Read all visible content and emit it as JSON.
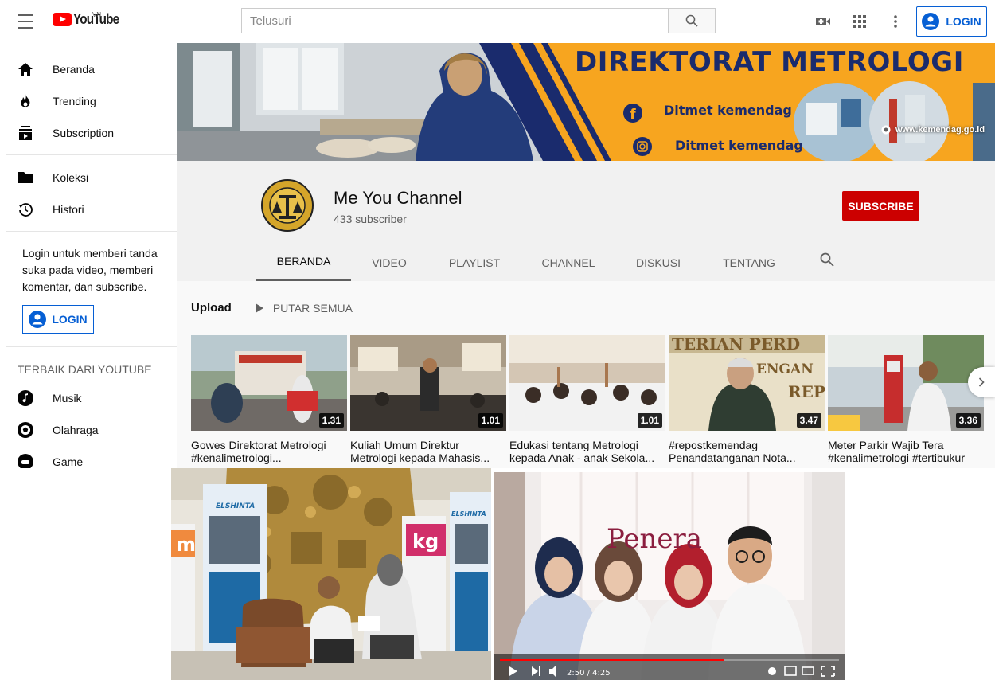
{
  "header": {
    "logo_text": "YouTube",
    "region": "VN",
    "search_placeholder": "Telusuri",
    "login_label": "LOGIN"
  },
  "sidebar": {
    "items": [
      {
        "label": "Beranda",
        "icon": "home-icon"
      },
      {
        "label": "Trending",
        "icon": "trending-icon"
      },
      {
        "label": "Subscription",
        "icon": "subscriptions-icon"
      }
    ],
    "library": [
      {
        "label": "Koleksi",
        "icon": "folder-icon"
      },
      {
        "label": "Histori",
        "icon": "history-icon"
      }
    ],
    "login_prompt": "Login untuk memberi tanda suka pada video, memberi komentar, dan subscribe.",
    "login_label": "LOGIN",
    "best_heading": "TERBAIK DARI YOUTUBE",
    "best": [
      {
        "label": "Musik",
        "icon": "music-icon"
      },
      {
        "label": "Olahraga",
        "icon": "sports-icon"
      },
      {
        "label": "Game",
        "icon": "gaming-icon"
      }
    ]
  },
  "banner": {
    "title": "DIREKTORAT METROLOGI",
    "facebook": "Ditmet kemendag",
    "instagram": "Ditmet kemendag",
    "link": "www.kemendag.go.id"
  },
  "channel": {
    "name": "Me You Channel",
    "subscribers": "433 subscriber",
    "subscribe_label": "SUBSCRIBE",
    "tabs": [
      "BERANDA",
      "VIDEO",
      "PLAYLIST",
      "CHANNEL",
      "DISKUSI",
      "TENTANG"
    ],
    "active_tab": "BERANDA"
  },
  "uploads": {
    "title": "Upload",
    "play_all": "PUTAR SEMUA",
    "videos": [
      {
        "title": "Gowes Direktorat Metrologi #kenalimetrologi...",
        "duration": "1.31"
      },
      {
        "title": "Kuliah Umum Direktur Metrologi kepada Mahasis...",
        "duration": "1.01"
      },
      {
        "title": "Edukasi tentang Metrologi kepada Anak - anak Sekola...",
        "duration": "1.01"
      },
      {
        "title": "#repostkemendag Penandatanganan Nota...",
        "duration": "3.47"
      },
      {
        "title": "Meter Parkir Wajib Tera #kenalimetrologi #tertibukur",
        "duration": "3.36"
      }
    ]
  },
  "photo1": {
    "sign_m": "m",
    "sign_kg": "kg",
    "banner_text": "ELSHINTA"
  },
  "photo2": {
    "caption": "Penera",
    "time": "2:50 / 4:25",
    "progress": 0.66
  },
  "colors": {
    "youtube_red": "#ff0000",
    "subscribe_red": "#cc0000",
    "link_blue": "#065fd4",
    "banner_orange": "#f7a51f",
    "banner_navy": "#1a2b6d"
  }
}
